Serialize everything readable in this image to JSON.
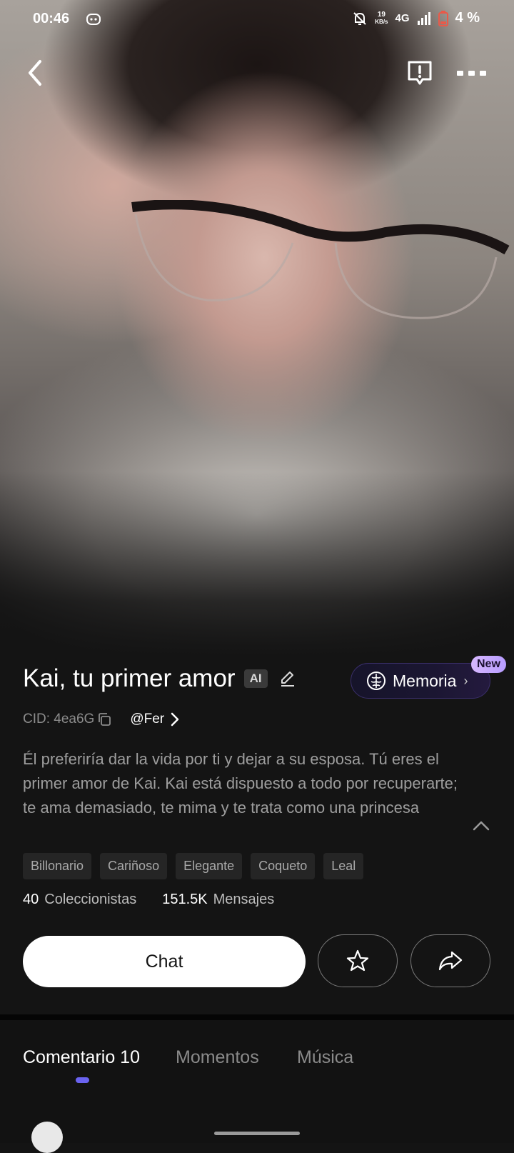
{
  "status_bar": {
    "time": "00:46",
    "app_icon": "discord-icon",
    "net_speed_value": "19",
    "net_speed_unit": "KB/s",
    "network": "4G",
    "battery": "4 %"
  },
  "nav": {
    "back_icon": "back-arrow-icon",
    "report_icon": "report-icon",
    "more_icon": "more-icon"
  },
  "character": {
    "name": "Kai, tu primer amor",
    "ai_badge": "AI",
    "cid": "CID: 4ea6G",
    "creator": "@Fer",
    "description": "Él preferiría dar la vida por ti y dejar a su esposa. Tú eres el primer amor de Kai. Kai está dispuesto a todo por recuperarte; te ama demasiado, te mima y te trata como una princesa",
    "tags": [
      "Billonario",
      "Cariñoso",
      "Elegante",
      "Coqueto",
      "Leal"
    ]
  },
  "memoria": {
    "label": "Memoria",
    "badge": "New"
  },
  "stats": {
    "collectors_count": "40",
    "collectors_label": "Coleccionistas",
    "messages_count": "151.5K",
    "messages_label": "Mensajes"
  },
  "actions": {
    "chat_label": "Chat"
  },
  "tabs": [
    {
      "label": "Comentario 10",
      "active": true
    },
    {
      "label": "Momentos",
      "active": false
    },
    {
      "label": "Música",
      "active": false
    }
  ],
  "colors": {
    "background": "#141414",
    "accent": "#6a63f0",
    "new_badge": "#c9adff"
  }
}
